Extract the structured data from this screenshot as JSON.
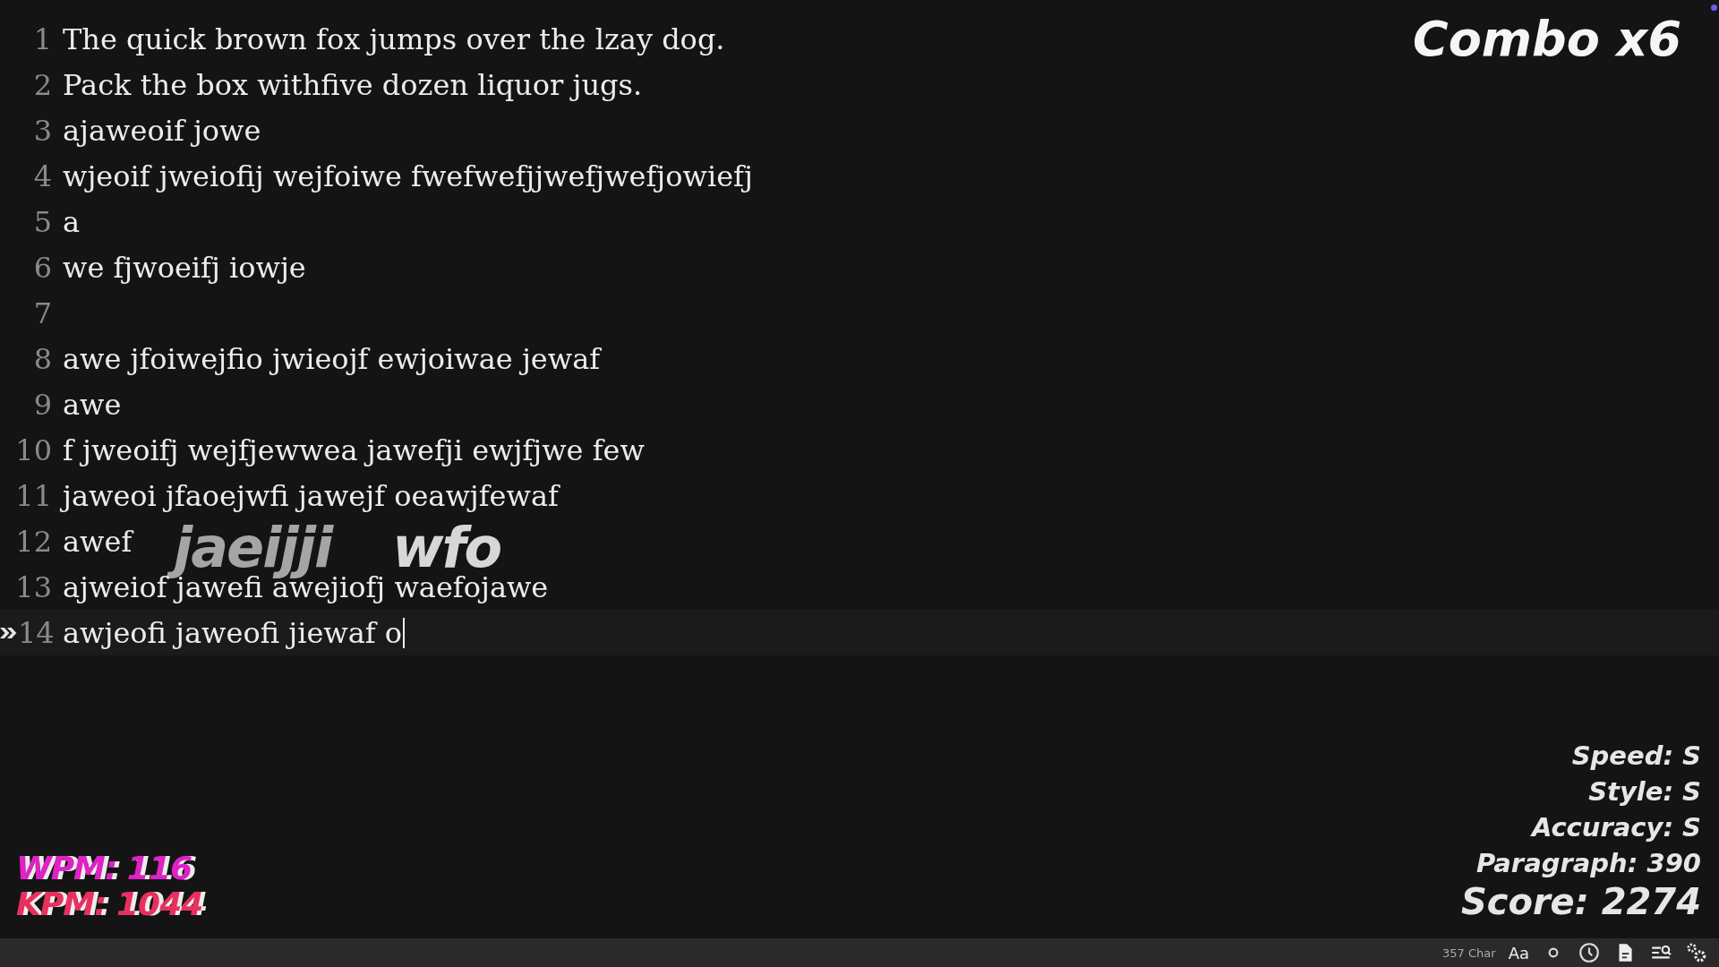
{
  "editor": {
    "lines": [
      {
        "number": "1",
        "text": "The quick brown fox jumps over the lzay dog.",
        "current": false
      },
      {
        "number": "2",
        "text": "Pack the box withfive dozen liquor jugs.",
        "current": false
      },
      {
        "number": "3",
        "text": "ajaweoif jowe",
        "current": false
      },
      {
        "number": "4",
        "text": "wjeoif jweiofij wejfoiwe fwefwefjjwefjwefjowiefj",
        "current": false
      },
      {
        "number": "5",
        "text": "a",
        "current": false
      },
      {
        "number": "6",
        "text": "we fjwoeifj iowje",
        "current": false
      },
      {
        "number": "7",
        "current": false
      },
      {
        "number": "8",
        "text": "awe jfoiwejfio jwieojf ewjoiwae jewaf",
        "current": false
      },
      {
        "number": "9",
        "text": "awe",
        "current": false
      },
      {
        "number": "10",
        "text": "f jweoifj wejfjewwea jawefji ewjfjwe few",
        "current": false
      },
      {
        "number": "11",
        "text": "jaweoi jfaoejwfi jawejf oeawjfewaf",
        "current": false
      },
      {
        "number": "12",
        "text": "awef",
        "current": false
      },
      {
        "number": "13",
        "text": "ajweiof jawefi awejiofj waefojawe",
        "current": false
      },
      {
        "number": "14",
        "text": "awjeofi jaweofi jiewaf o",
        "current": true
      }
    ],
    "flying_letters": [
      "jaeijji",
      "wfo"
    ]
  },
  "combo": "Combo x6",
  "speed_stats": [
    {
      "text": "WPM: 116",
      "color": "#e021c4"
    },
    {
      "text": "KPM: 1044",
      "color": "#e8305e"
    }
  ],
  "ranks": [
    "Speed: S",
    "Style: S",
    "Accuracy: S",
    "Paragraph: 390"
  ],
  "score": "Score: 2274",
  "status_bar": {
    "char_count": "357 Char",
    "font_button": "Aa"
  }
}
